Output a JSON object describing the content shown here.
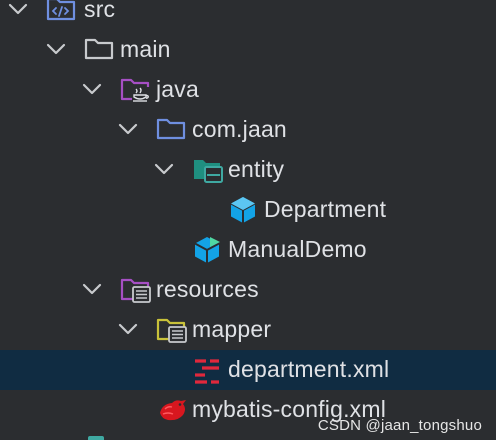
{
  "tree": {
    "rows": [
      {
        "label": "src",
        "icon": "source-folder-icon",
        "expanded": true
      },
      {
        "label": "main",
        "icon": "folder-icon",
        "expanded": true
      },
      {
        "label": "java",
        "icon": "java-source-root-icon",
        "expanded": true
      },
      {
        "label": "com.jaan",
        "icon": "package-icon",
        "expanded": true
      },
      {
        "label": "entity",
        "icon": "entity-package-icon",
        "expanded": true
      },
      {
        "label": "Department",
        "icon": "class-icon"
      },
      {
        "label": "ManualDemo",
        "icon": "runnable-class-icon"
      },
      {
        "label": "resources",
        "icon": "resources-root-icon",
        "expanded": true
      },
      {
        "label": "mapper",
        "icon": "mapper-folder-icon",
        "expanded": true
      },
      {
        "label": "department.xml",
        "icon": "mybatis-xml-icon",
        "selected": true
      },
      {
        "label": "mybatis-config.xml",
        "icon": "mybatis-bird-icon"
      }
    ]
  },
  "watermark": {
    "text": "CSDN @jaan_tongshuo"
  },
  "colors": {
    "background": "#2b2d30",
    "selection": "#102c42",
    "text": "#dfe1e5",
    "chevron": "#c8cacd",
    "folder_blue": "#6f8fe0",
    "folder_purple": "#a64fc4",
    "class_cyan": "#13a3e6",
    "mybatis_red": "#e0283c",
    "entity_green": "#1f8f80"
  }
}
